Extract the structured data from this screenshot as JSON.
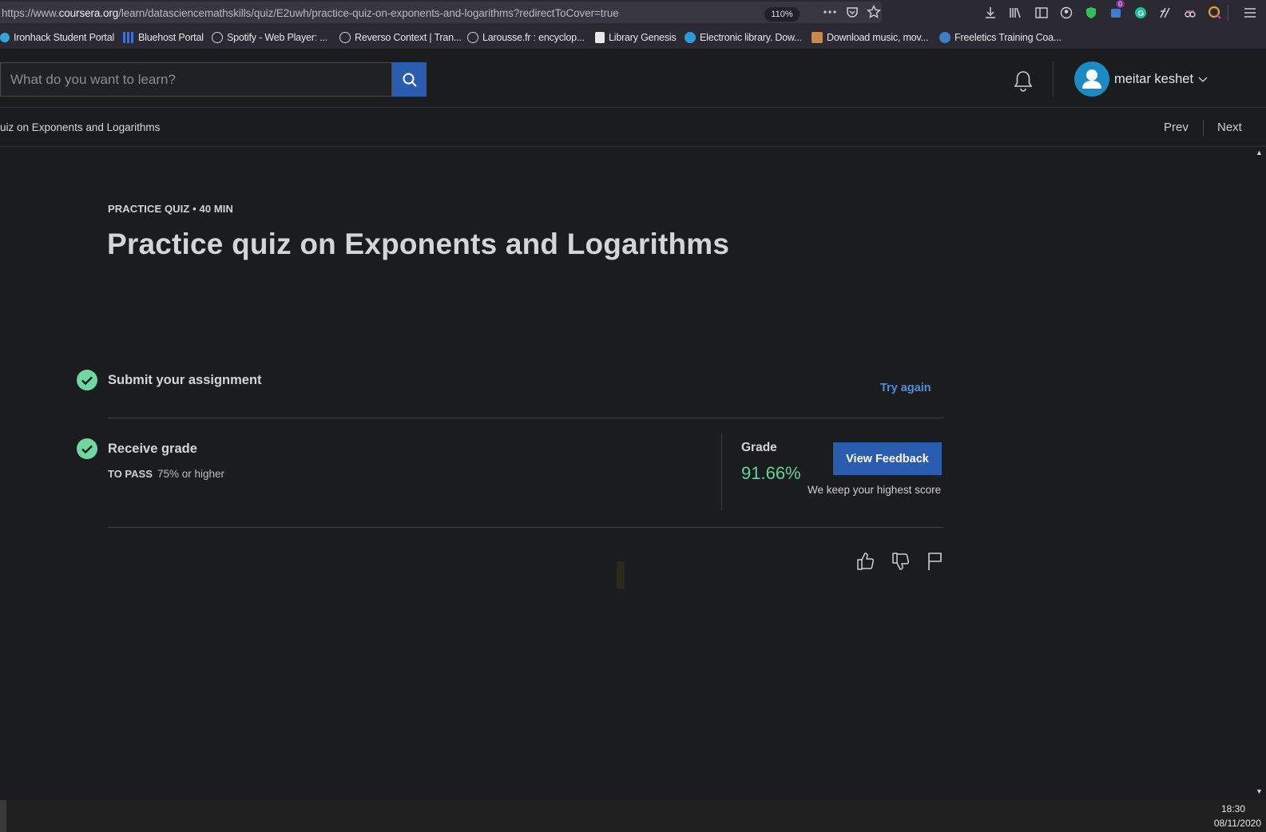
{
  "browser": {
    "url_prefix": "https://www.",
    "url_host": "coursera.org",
    "url_path": "/learn/datasciencemathskills/quiz/E2uwh/practice-quiz-on-exponents-and-logarithms?redirectToCover=true",
    "zoom": "110%",
    "bookmarks": [
      {
        "label": "Ironhack Student Portal",
        "icon": "shield-icon"
      },
      {
        "label": "Bluehost Portal",
        "icon": "grid-icon"
      },
      {
        "label": "Spotify - Web Player: ...",
        "icon": "globe-icon"
      },
      {
        "label": "Reverso Context | Tran...",
        "icon": "globe-icon"
      },
      {
        "label": "Larousse.fr : encyclop...",
        "icon": "globe-icon"
      },
      {
        "label": "Library Genesis",
        "icon": "book-icon"
      },
      {
        "label": "Electronic library. Dow...",
        "icon": "globe-icon"
      },
      {
        "label": "Download music, mov...",
        "icon": "image-icon"
      },
      {
        "label": "Freeletics Training Coa...",
        "icon": "wordpress-icon"
      }
    ],
    "badge_count": "0"
  },
  "header": {
    "search_placeholder": "What do you want to learn?",
    "username": "meitar keshet"
  },
  "breadcrumb": {
    "text": "uiz on Exponents and Logarithms",
    "prev": "Prev",
    "next": "Next"
  },
  "quiz": {
    "meta": "PRACTICE QUIZ • 40 MIN",
    "title": "Practice quiz on Exponents and Logarithms",
    "step1": "Submit your assignment",
    "try_again": "Try again",
    "step2": "Receive grade",
    "pass_label": "TO PASS",
    "pass_value": "75% or higher",
    "grade_label": "Grade",
    "grade_value": "91.66%",
    "feedback_button": "View Feedback",
    "keep_score": "We keep your highest score"
  },
  "taskbar": {
    "time": "18:30",
    "date": "08/11/2020"
  },
  "colors": {
    "accent": "#2a5db0",
    "success": "#6fd8a1",
    "link": "#4d8fdc"
  }
}
